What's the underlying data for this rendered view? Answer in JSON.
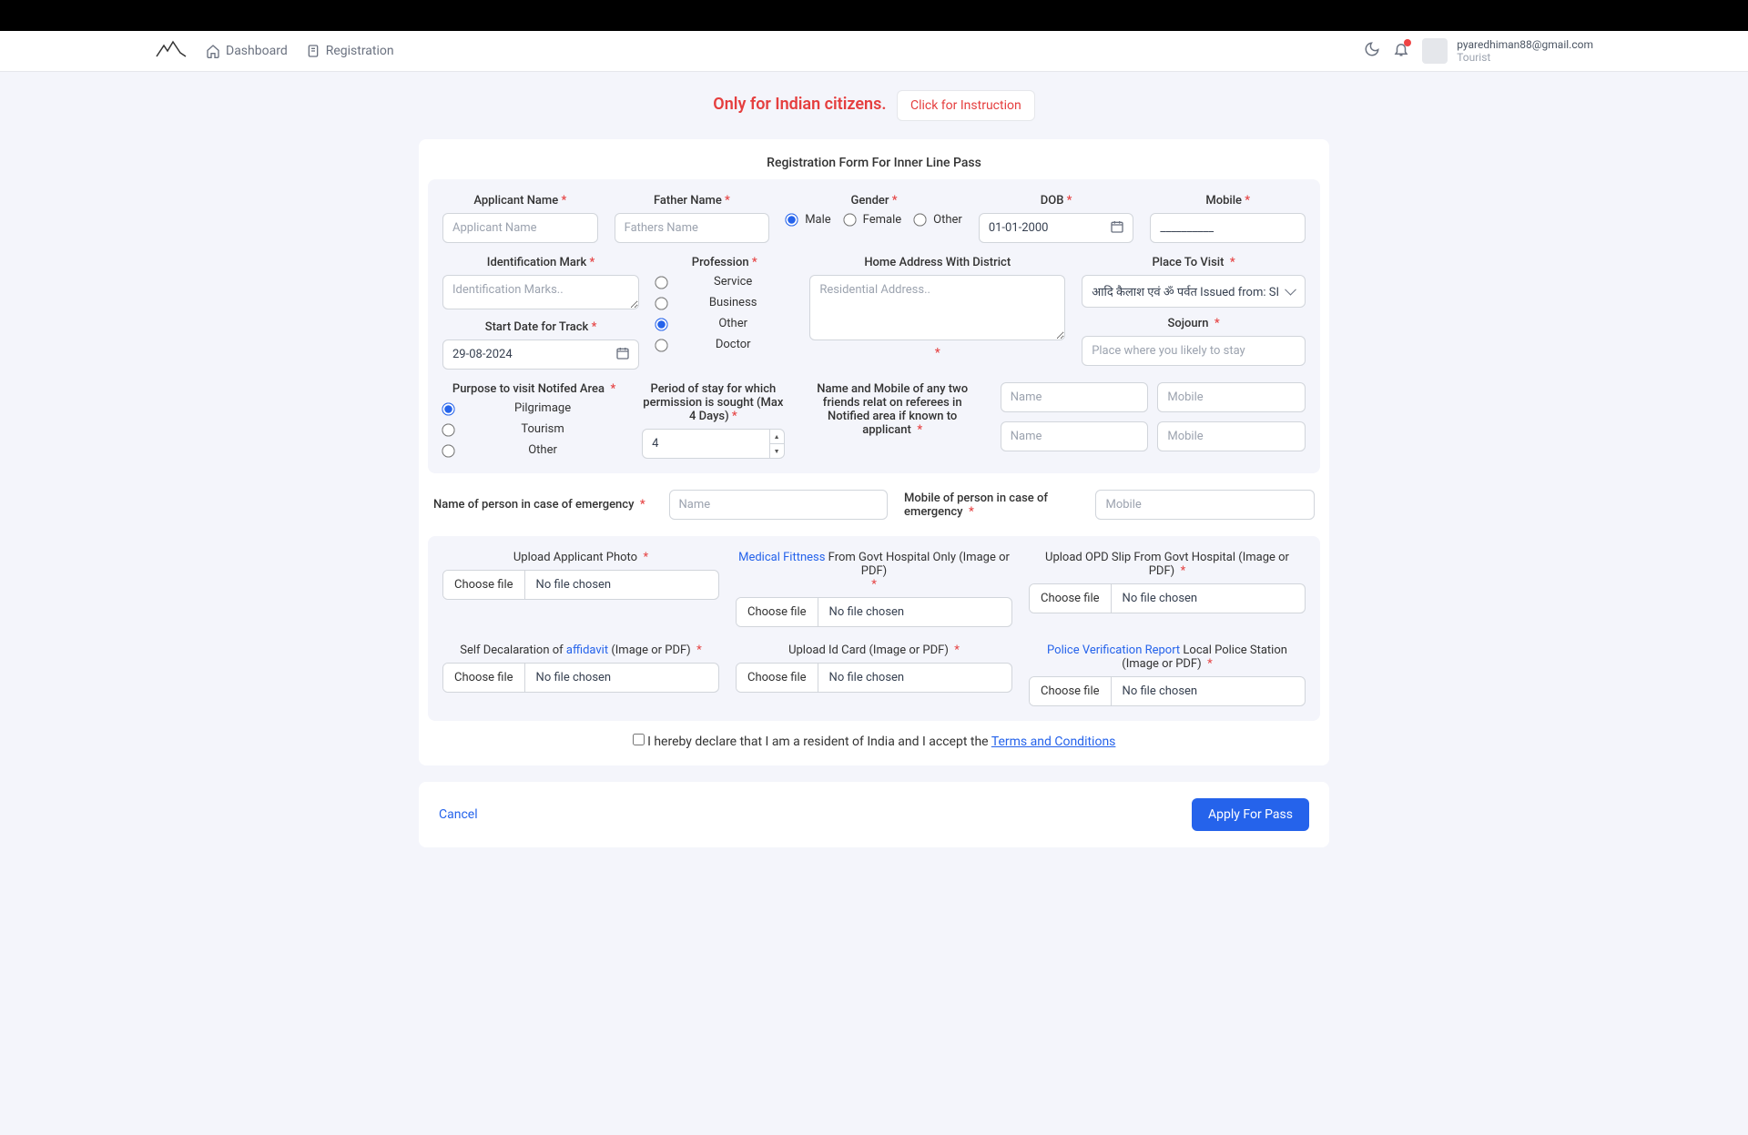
{
  "header": {
    "nav": {
      "dashboard": "Dashboard",
      "registration": "Registration"
    },
    "user": {
      "email": "pyaredhiman88@gmail.com",
      "role": "Tourist"
    }
  },
  "banner": {
    "text": "Only for Indian citizens.",
    "button": "Click for Instruction"
  },
  "form": {
    "title": "Registration Form For Inner Line Pass",
    "labels": {
      "applicant_name": "Applicant Name",
      "father_name": "Father Name",
      "gender": "Gender",
      "dob": "DOB",
      "mobile": "Mobile",
      "id_mark": "Identification Mark",
      "profession": "Profession",
      "home_address": "Home Address With District",
      "place_to_visit": "Place To Visit",
      "start_date": "Start Date for Track",
      "sojourn": "Sojourn",
      "purpose": "Purpose to visit Notifed Area",
      "period": "Period of stay for which permission is sought (Max 4 Days)",
      "referees": "Name and Mobile of any two friends relat on referees in Notified area if known to applicant",
      "emergency_name": "Name of person in case of emergency",
      "emergency_mobile": "Mobile of person in case of emergency",
      "upload_photo": "Upload Applicant Photo",
      "medical_link": "Medical Fittness",
      "medical_rest": " From Govt Hospital Only (Image or PDF)",
      "opd": "Upload OPD Slip From Govt Hospital (Image or PDF)",
      "affidavit_pre": "Self Decalaration of ",
      "affidavit_link": "affidavit",
      "affidavit_post": " (Image or PDF)",
      "id_card": "Upload Id Card (Image or PDF)",
      "police_link": "Police Verification Report",
      "police_rest": " Local Police Station (Image or PDF)"
    },
    "placeholders": {
      "applicant_name": "Applicant Name",
      "father_name": "Fathers Name",
      "id_mark": "Identification Marks..",
      "home_address": "Residential Address..",
      "sojourn": "Place where you likely to stay",
      "name": "Name",
      "mobile": "Mobile"
    },
    "values": {
      "dob": "01-01-2000",
      "start_date": "29-08-2024",
      "place_to_visit": "आदि कैलाश एवं ॐ पर्वत Issued from: SI",
      "period": "4",
      "mobile_mask": "__________"
    },
    "gender_options": {
      "male": "Male",
      "female": "Female",
      "other": "Other"
    },
    "profession_options": {
      "service": "Service",
      "business": "Business",
      "other": "Other",
      "doctor": "Doctor"
    },
    "purpose_options": {
      "pilgrimage": "Pilgrimage",
      "tourism": "Tourism",
      "other": "Other"
    },
    "file": {
      "choose": "Choose file",
      "none": "No file chosen"
    },
    "declaration_pre": "I hereby declare that I am a resident of India and I accept the ",
    "declaration_link": "Terms and Conditions",
    "footer": {
      "cancel": "Cancel",
      "apply": "Apply For Pass"
    }
  }
}
